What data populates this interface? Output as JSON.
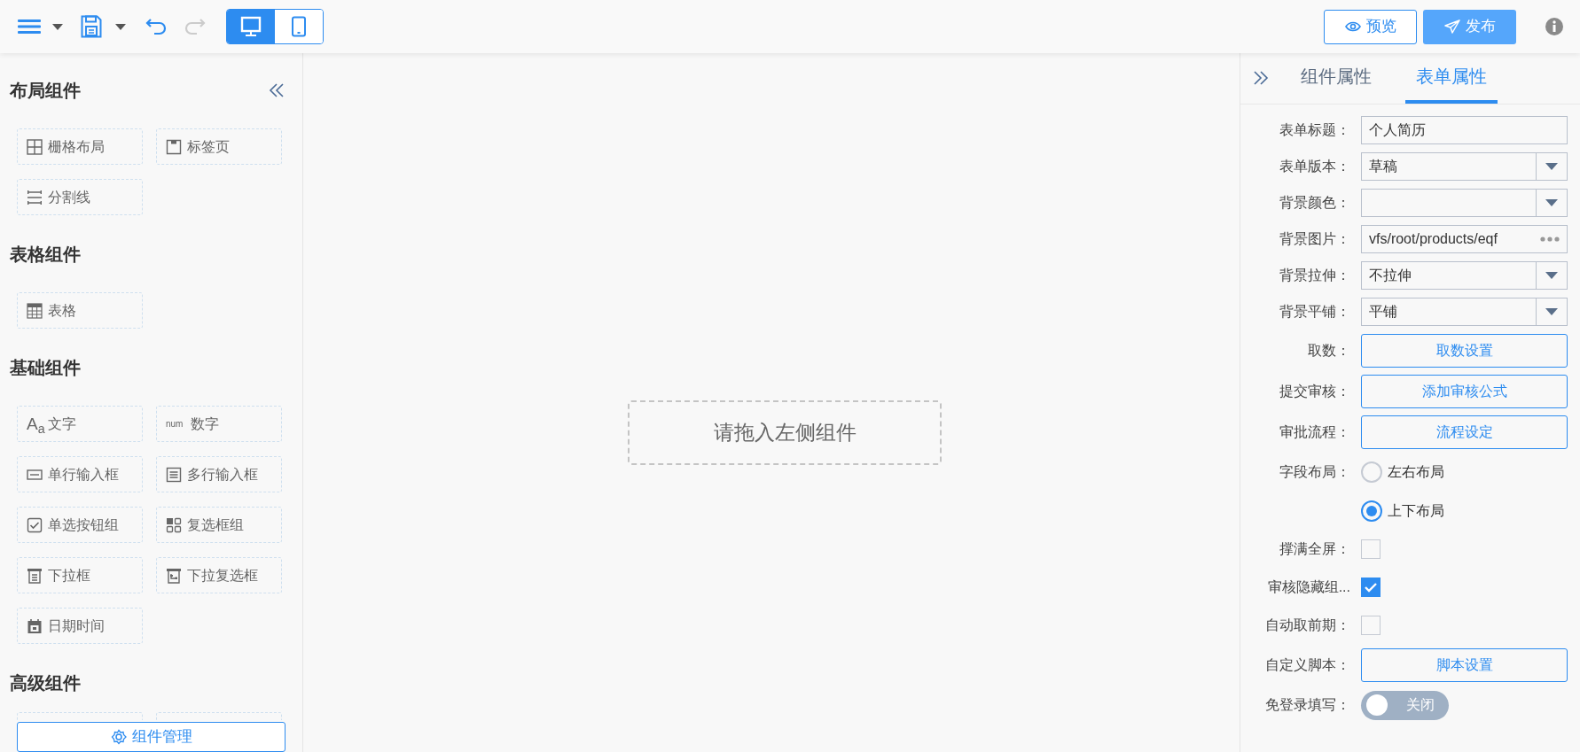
{
  "header": {
    "undo": {
      "disabled": false
    },
    "redo": {
      "disabled": true
    },
    "device_toggle": [
      {
        "kind": "desktop",
        "selected": true
      },
      {
        "kind": "mobile",
        "selected": false
      }
    ],
    "buttons": [
      {
        "kind": "preview",
        "label": "预览"
      },
      {
        "kind": "publish",
        "label": "发布"
      }
    ]
  },
  "left_panel": {
    "sections": [
      {
        "title": "布局组件",
        "items": [
          {
            "kind": "grid",
            "label": "栅格布局"
          },
          {
            "kind": "tab",
            "label": "标签页"
          },
          {
            "kind": "divider",
            "label": "分割线"
          }
        ]
      },
      {
        "title": "表格组件",
        "items": [
          {
            "kind": "table",
            "label": "表格"
          }
        ]
      },
      {
        "title": "基础组件",
        "items": [
          {
            "kind": "text",
            "icon_text": "A$_{a}$",
            "label": "文字"
          },
          {
            "kind": "number",
            "icon_text": "num",
            "label": "数字"
          },
          {
            "kind": "input",
            "label": "单行输入框"
          },
          {
            "kind": "textarea",
            "label": "多行输入框"
          },
          {
            "kind": "radio",
            "label": "单选按钮组"
          },
          {
            "kind": "checkbox",
            "label": "复选框组"
          },
          {
            "kind": "select",
            "label": "下拉框"
          },
          {
            "kind": "multiselect",
            "label": "下拉复选框"
          },
          {
            "kind": "datetime",
            "label": "日期时间"
          }
        ]
      },
      {
        "title": "高级组件"
      }
    ],
    "manage_button": "组件管理"
  },
  "canvas": {
    "placeholder": "请拖入左侧组件"
  },
  "right_panel": {
    "tabs": [
      {
        "label": "组件属性",
        "selected": false
      },
      {
        "label": "表单属性",
        "selected": true
      }
    ],
    "fields": [
      {
        "kind": "text",
        "label": "表单标题：",
        "value": "个人简历"
      },
      {
        "kind": "select",
        "label": "表单版本：",
        "value": "草稿"
      },
      {
        "kind": "select",
        "label": "背景颜色："
      },
      {
        "kind": "picker",
        "label": "背景图片：",
        "value": "vfs/root/products/eqf"
      },
      {
        "kind": "select",
        "label": "背景拉伸：",
        "value": "不拉伸"
      },
      {
        "kind": "select",
        "label": "背景平铺：",
        "value": "平铺"
      },
      {
        "kind": "button",
        "label": "取数：",
        "button": "取数设置"
      },
      {
        "kind": "button",
        "label": "提交审核：",
        "button": "添加审核公式"
      },
      {
        "kind": "button",
        "label": "审批流程：",
        "button": "流程设定"
      },
      {
        "kind": "radio",
        "label": "字段布局：",
        "options": [
          {
            "label": "左右布局",
            "selected": false
          },
          {
            "label": "上下布局",
            "selected": true
          }
        ]
      },
      {
        "kind": "checkbox",
        "label": "撑满全屏：",
        "checked": false
      },
      {
        "kind": "checkbox",
        "label": "审核隐藏组...",
        "checked": true
      },
      {
        "kind": "checkbox",
        "label": "自动取前期：",
        "checked": false
      },
      {
        "kind": "button",
        "label": "自定义脚本：",
        "button": "脚本设置"
      },
      {
        "kind": "switch",
        "label": "免登录填写：",
        "on": false,
        "text": "关闭"
      }
    ]
  }
}
